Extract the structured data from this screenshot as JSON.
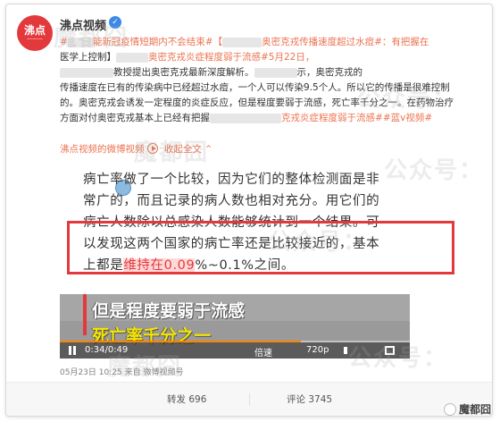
{
  "author": {
    "avatar_text": "沸点",
    "avatar_sub": "一一一",
    "name": "沸点视频"
  },
  "post": {
    "line1_hashtag": "#",
    "line1_a": "能新冠疫情短期内不会结束#【",
    "line1_b": "奥密克戎传播速度超过水痘#：有把握在",
    "line2": "医学上控制】",
    "line2_hashtag": "奥密克戎炎症程度弱于流感#5月22日，",
    "line3_a": "教授提出奥密克戎最新深度解析。",
    "line3_b": "示，奥密克戎的",
    "line4": "传播速度在已有的传染病中已经超过水痘，一个人可以传染9.5个人。所以它的传播是很难控制",
    "line5": "的。奥密克戎会诱发一定程度的炎症反应，但是程度要弱于流感，死亡率千分之一。在药物治疗",
    "line6_a": "方面对付奥密克戎基本上已经有把握",
    "line6_b": "克戎炎症程度弱于流感#",
    "line6_c": "#蓝v视频#"
  },
  "links": {
    "source": "沸点视频的微博视频",
    "collapse": "收起全文",
    "collapse_icon": "chevron-up-icon"
  },
  "article": {
    "line1": "病亡率做了一个比较，因为它们的整体检测面是非",
    "line2": "常广的，而且记录的病人数也相对充分。用它们的",
    "line3": "病亡人数除以总感染人数能够统计到一个结果。可",
    "line4": "以发现这两个国家的病亡率还是比较接近的，基本",
    "line5_a": "上都是",
    "line5_red": "维持在0.09",
    "line5_b": "%~0.1%之间。"
  },
  "video": {
    "caption1": "但是程度要弱于流感",
    "caption2": "死亡率千分之一",
    "time": "0:34/0:49",
    "progress": 0.69,
    "speed": "倍速",
    "quality": "720p"
  },
  "meta": {
    "date": "05月23日 10:25",
    "source_prefix": "来自",
    "source": "微博视频号"
  },
  "actions": {
    "repost": "转发 696",
    "comment": "评论 3745"
  },
  "watermark": {
    "text1": "魔都囧",
    "text2": "公众号：",
    "brand": "魔都囧"
  },
  "colors": {
    "accent": "#eb7350",
    "highlight_red": "#e4393c",
    "verified_blue": "#3c8ae6",
    "caption_yellow": "#f5e600"
  }
}
